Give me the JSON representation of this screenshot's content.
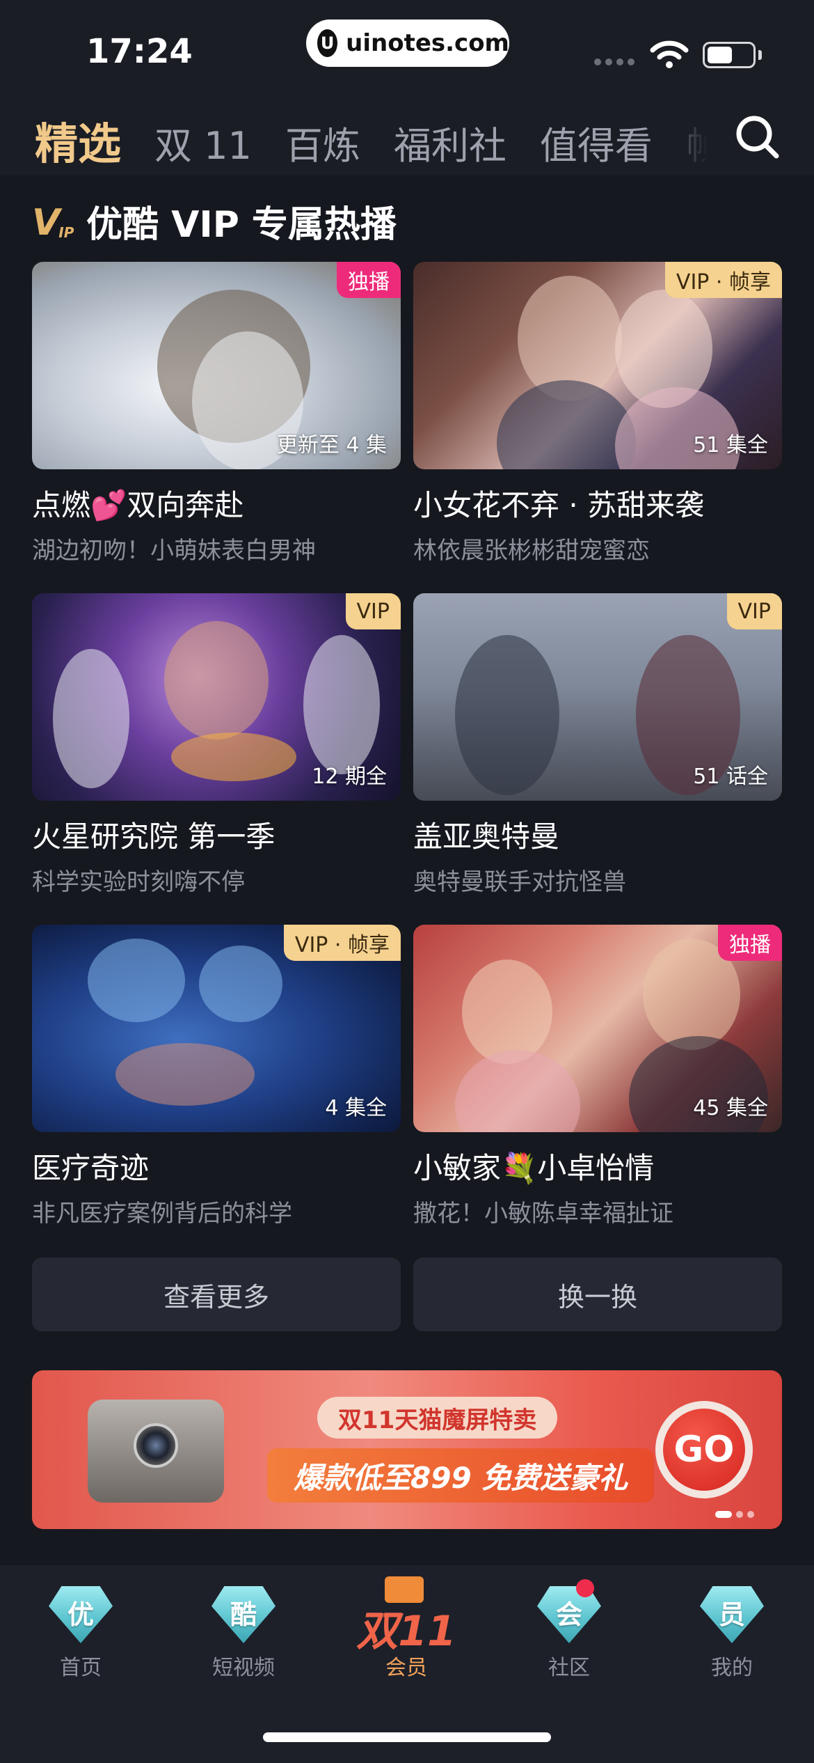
{
  "status_bar": {
    "time": "17:24",
    "url": "uinotes.com",
    "url_logo": "U",
    "battery_level": 0.55
  },
  "top_nav": {
    "tabs": [
      {
        "label": "精选",
        "active": true
      },
      {
        "label": "双 11"
      },
      {
        "label": "百炼"
      },
      {
        "label": "福利社"
      },
      {
        "label": "值得看"
      },
      {
        "label": "帧"
      }
    ],
    "search_icon": "search-icon"
  },
  "section": {
    "logo_v": "V",
    "logo_ip": "IP",
    "title": "优酷 VIP 专属热播"
  },
  "cards": [
    {
      "badge": "独播",
      "badge_type": "exclusive",
      "episodes": "更新至 4 集",
      "title": "点燃💕双向奔赴",
      "subtitle": "湖边初吻！小萌妹表白男神"
    },
    {
      "badge": "VIP · 帧享",
      "badge_type": "vip",
      "episodes": "51 集全",
      "title": "小女花不弃 · 苏甜来袭",
      "subtitle": "林依晨张彬彬甜宠蜜恋"
    },
    {
      "badge": "VIP",
      "badge_type": "vip",
      "episodes": "12 期全",
      "title": "火星研究院 第一季",
      "subtitle": "科学实验时刻嗨不停"
    },
    {
      "badge": "VIP",
      "badge_type": "vip",
      "episodes": "51 话全",
      "title": "盖亚奥特曼",
      "subtitle": "奥特曼联手对抗怪兽"
    },
    {
      "badge": "VIP · 帧享",
      "badge_type": "vip",
      "episodes": "4 集全",
      "title": "医疗奇迹",
      "subtitle": "非凡医疗案例背后的科学"
    },
    {
      "badge": "独播",
      "badge_type": "exclusive",
      "episodes": "45 集全",
      "title": "小敏家💐小卓怡情",
      "subtitle": "撒花！小敏陈卓幸福扯证"
    }
  ],
  "actions": {
    "more": "查看更多",
    "refresh": "换一换"
  },
  "banner": {
    "line1": "双11天猫魔屏特卖",
    "line2": "爆款低至899 免费送豪礼",
    "cta": "GO"
  },
  "bottom_nav": [
    {
      "icon_text": "优",
      "label": "首页"
    },
    {
      "icon_text": "酷",
      "label": "短视频"
    },
    {
      "icon_text": "双11",
      "label": "会员",
      "active": true
    },
    {
      "icon_text": "会",
      "label": "社区",
      "dot": true
    },
    {
      "icon_text": "员",
      "label": "我的"
    }
  ],
  "colors": {
    "accent_gold": "#f1c98a",
    "exclusive_pink": "#ee2b7a",
    "vip_gold": "#f5d28f",
    "background": "#16181f"
  }
}
